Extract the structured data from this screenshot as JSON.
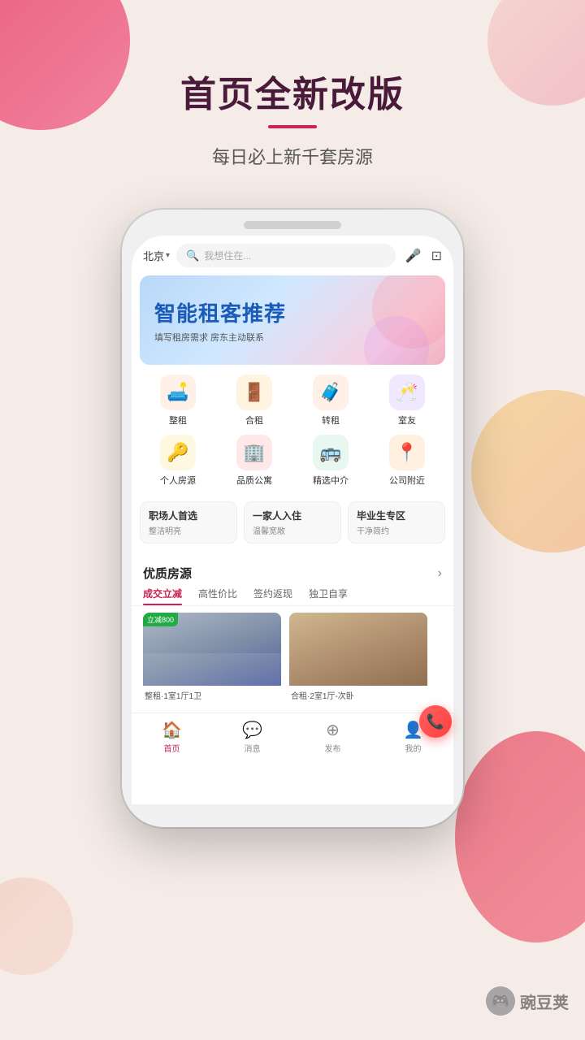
{
  "header": {
    "main_title": "首页全新改版",
    "underline": true,
    "sub_title": "每日必上新千套房源"
  },
  "search": {
    "city": "北京",
    "city_arrow": "▾",
    "placeholder": "我想住在...",
    "mic_icon": "🎤",
    "scan_icon": "⊡"
  },
  "banner": {
    "title": "智能租客推荐",
    "sub": "填写租房需求  房东主动联系"
  },
  "categories": {
    "row1": [
      {
        "icon": "🛋️",
        "label": "整租",
        "bg": "#fff0e8"
      },
      {
        "icon": "🚪",
        "label": "合租",
        "bg": "#fff4e0"
      },
      {
        "icon": "🧳",
        "label": "转租",
        "bg": "#fff0e8"
      },
      {
        "icon": "🥂",
        "label": "室友",
        "bg": "#f0e8ff"
      }
    ],
    "row2": [
      {
        "icon": "🔑",
        "label": "个人房源",
        "bg": "#fff8e0"
      },
      {
        "icon": "🏢",
        "label": "品质公寓",
        "bg": "#ffe8e8"
      },
      {
        "icon": "🚌",
        "label": "精选中介",
        "bg": "#e8f8f0"
      },
      {
        "icon": "📍",
        "label": "公司附近",
        "bg": "#fff0e0"
      }
    ]
  },
  "tag_banners": [
    {
      "title": "职场人首选",
      "sub": "整洁明亮"
    },
    {
      "title": "一家人入住",
      "sub": "温馨宽敞"
    },
    {
      "title": "毕业生专区",
      "sub": "干净简约"
    }
  ],
  "quality": {
    "title": "优质房源",
    "arrow": "›",
    "tabs": [
      {
        "label": "成交立减",
        "active": true
      },
      {
        "label": "高性价比",
        "active": false
      },
      {
        "label": "签约返现",
        "active": false
      },
      {
        "label": "独卫自享",
        "active": false
      }
    ],
    "cards": [
      {
        "badge": "立减800",
        "type": "整租",
        "desc": "整租·1室1厅1卫"
      },
      {
        "badge": null,
        "type": "合租",
        "desc": "合租·2室1厅-次卧"
      }
    ]
  },
  "bottom_nav": [
    {
      "icon": "🏠",
      "label": "首页",
      "active": true
    },
    {
      "icon": "💬",
      "label": "消息",
      "active": false
    },
    {
      "icon": "⊕",
      "label": "发布",
      "active": false
    },
    {
      "icon": "👤",
      "label": "我的",
      "active": false
    }
  ],
  "watermark": {
    "text": "豌豆荚"
  }
}
